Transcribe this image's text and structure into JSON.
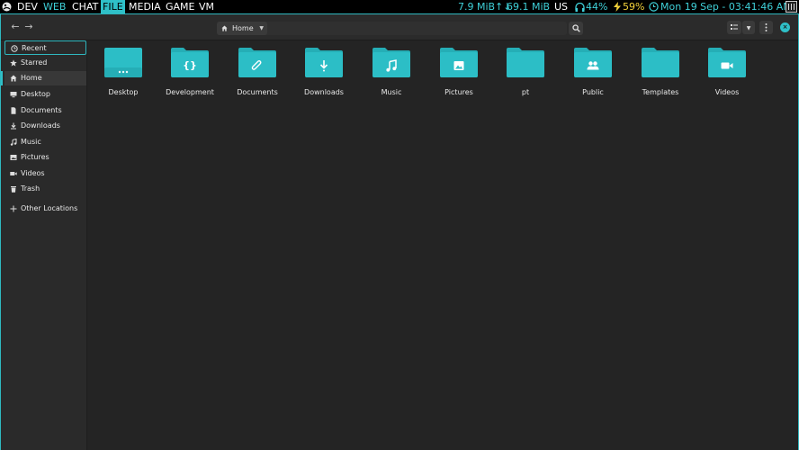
{
  "topbar": {
    "workspaces": [
      "DEV",
      "WEB",
      "CHAT",
      "FILE",
      "MEDIA",
      "GAME",
      "VM"
    ],
    "net_down": "7.9 MiB",
    "net_up": "69.1 MiB",
    "net_icon": "↑↓",
    "keyboard": "US",
    "volume": "44%",
    "battery": "59%",
    "datetime": "Mon 19 Sep - 03:41:46 AM"
  },
  "header": {
    "path_label": "Home"
  },
  "sidebar": {
    "items": [
      {
        "label": "Recent",
        "icon": "clock-icon"
      },
      {
        "label": "Starred",
        "icon": "star-icon"
      },
      {
        "label": "Home",
        "icon": "home-icon"
      },
      {
        "label": "Desktop",
        "icon": "desktop-icon"
      },
      {
        "label": "Documents",
        "icon": "document-icon"
      },
      {
        "label": "Downloads",
        "icon": "download-icon"
      },
      {
        "label": "Music",
        "icon": "music-icon"
      },
      {
        "label": "Pictures",
        "icon": "picture-icon"
      },
      {
        "label": "Videos",
        "icon": "video-icon"
      },
      {
        "label": "Trash",
        "icon": "trash-icon"
      },
      {
        "label": "Other Locations",
        "icon": "plus-icon"
      }
    ]
  },
  "folders": [
    {
      "name": "Desktop",
      "emblem": "dots"
    },
    {
      "name": "Development",
      "emblem": "braces"
    },
    {
      "name": "Documents",
      "emblem": "paperclip"
    },
    {
      "name": "Downloads",
      "emblem": "download"
    },
    {
      "name": "Music",
      "emblem": "note"
    },
    {
      "name": "Pictures",
      "emblem": "image"
    },
    {
      "name": "pt",
      "emblem": "none"
    },
    {
      "name": "Public",
      "emblem": "people"
    },
    {
      "name": "Templates",
      "emblem": "none"
    },
    {
      "name": "Videos",
      "emblem": "camera"
    }
  ],
  "colors": {
    "accent": "#2fc0c8",
    "folder": "#2cbec6",
    "window_bg": "#242424",
    "sidebar_bg": "#2a2a2a"
  }
}
